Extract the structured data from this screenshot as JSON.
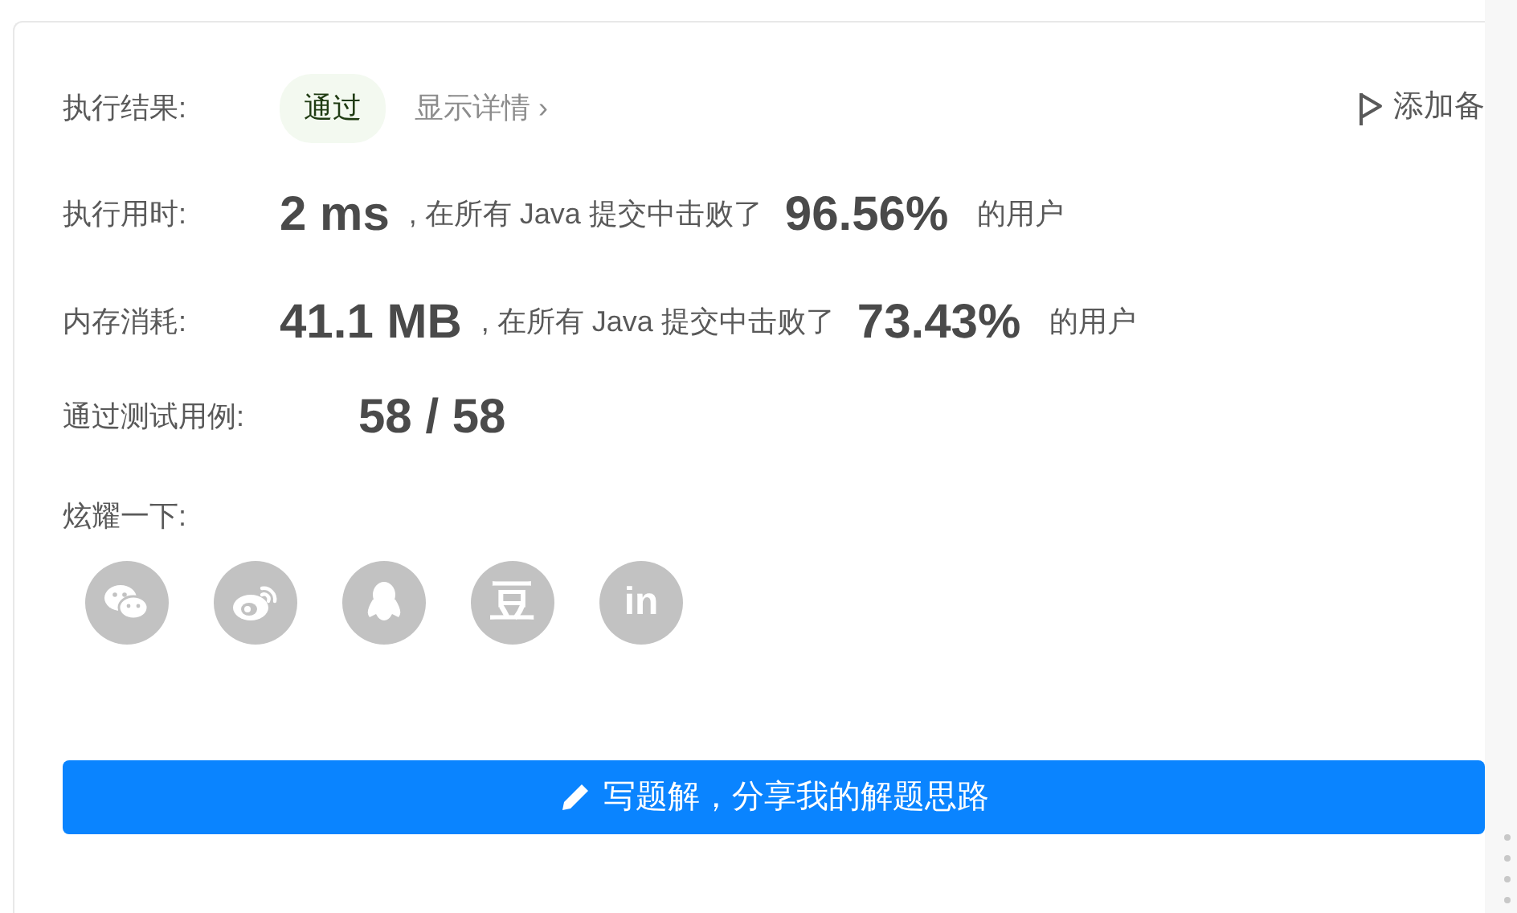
{
  "result": {
    "label": "执行结果:",
    "status": "通过",
    "passed": true,
    "details_link": "显示详情",
    "details_chevron": "›"
  },
  "add_note": {
    "label": "添加备"
  },
  "metrics": [
    {
      "label": "执行用时:",
      "value": "2 ms",
      "text": ", 在所有 Java 提交中击败了",
      "percent": "96.56%",
      "suffix": "的用户"
    },
    {
      "label": "内存消耗:",
      "value": "41.1 MB",
      "text": ", 在所有 Java 提交中击败了",
      "percent": "73.43%",
      "suffix": "的用户"
    }
  ],
  "tests": {
    "label": "通过测试用例:",
    "value": "58 / 58"
  },
  "share": {
    "label": "炫耀一下:",
    "icons": [
      {
        "kind": "wechat"
      },
      {
        "kind": "weibo"
      },
      {
        "kind": "qq"
      },
      {
        "kind": "douban",
        "glyph": "豆"
      },
      {
        "kind": "linkedin",
        "glyph": "in"
      }
    ]
  },
  "solution_button": {
    "label": "写题解，分享我的解题思路"
  }
}
